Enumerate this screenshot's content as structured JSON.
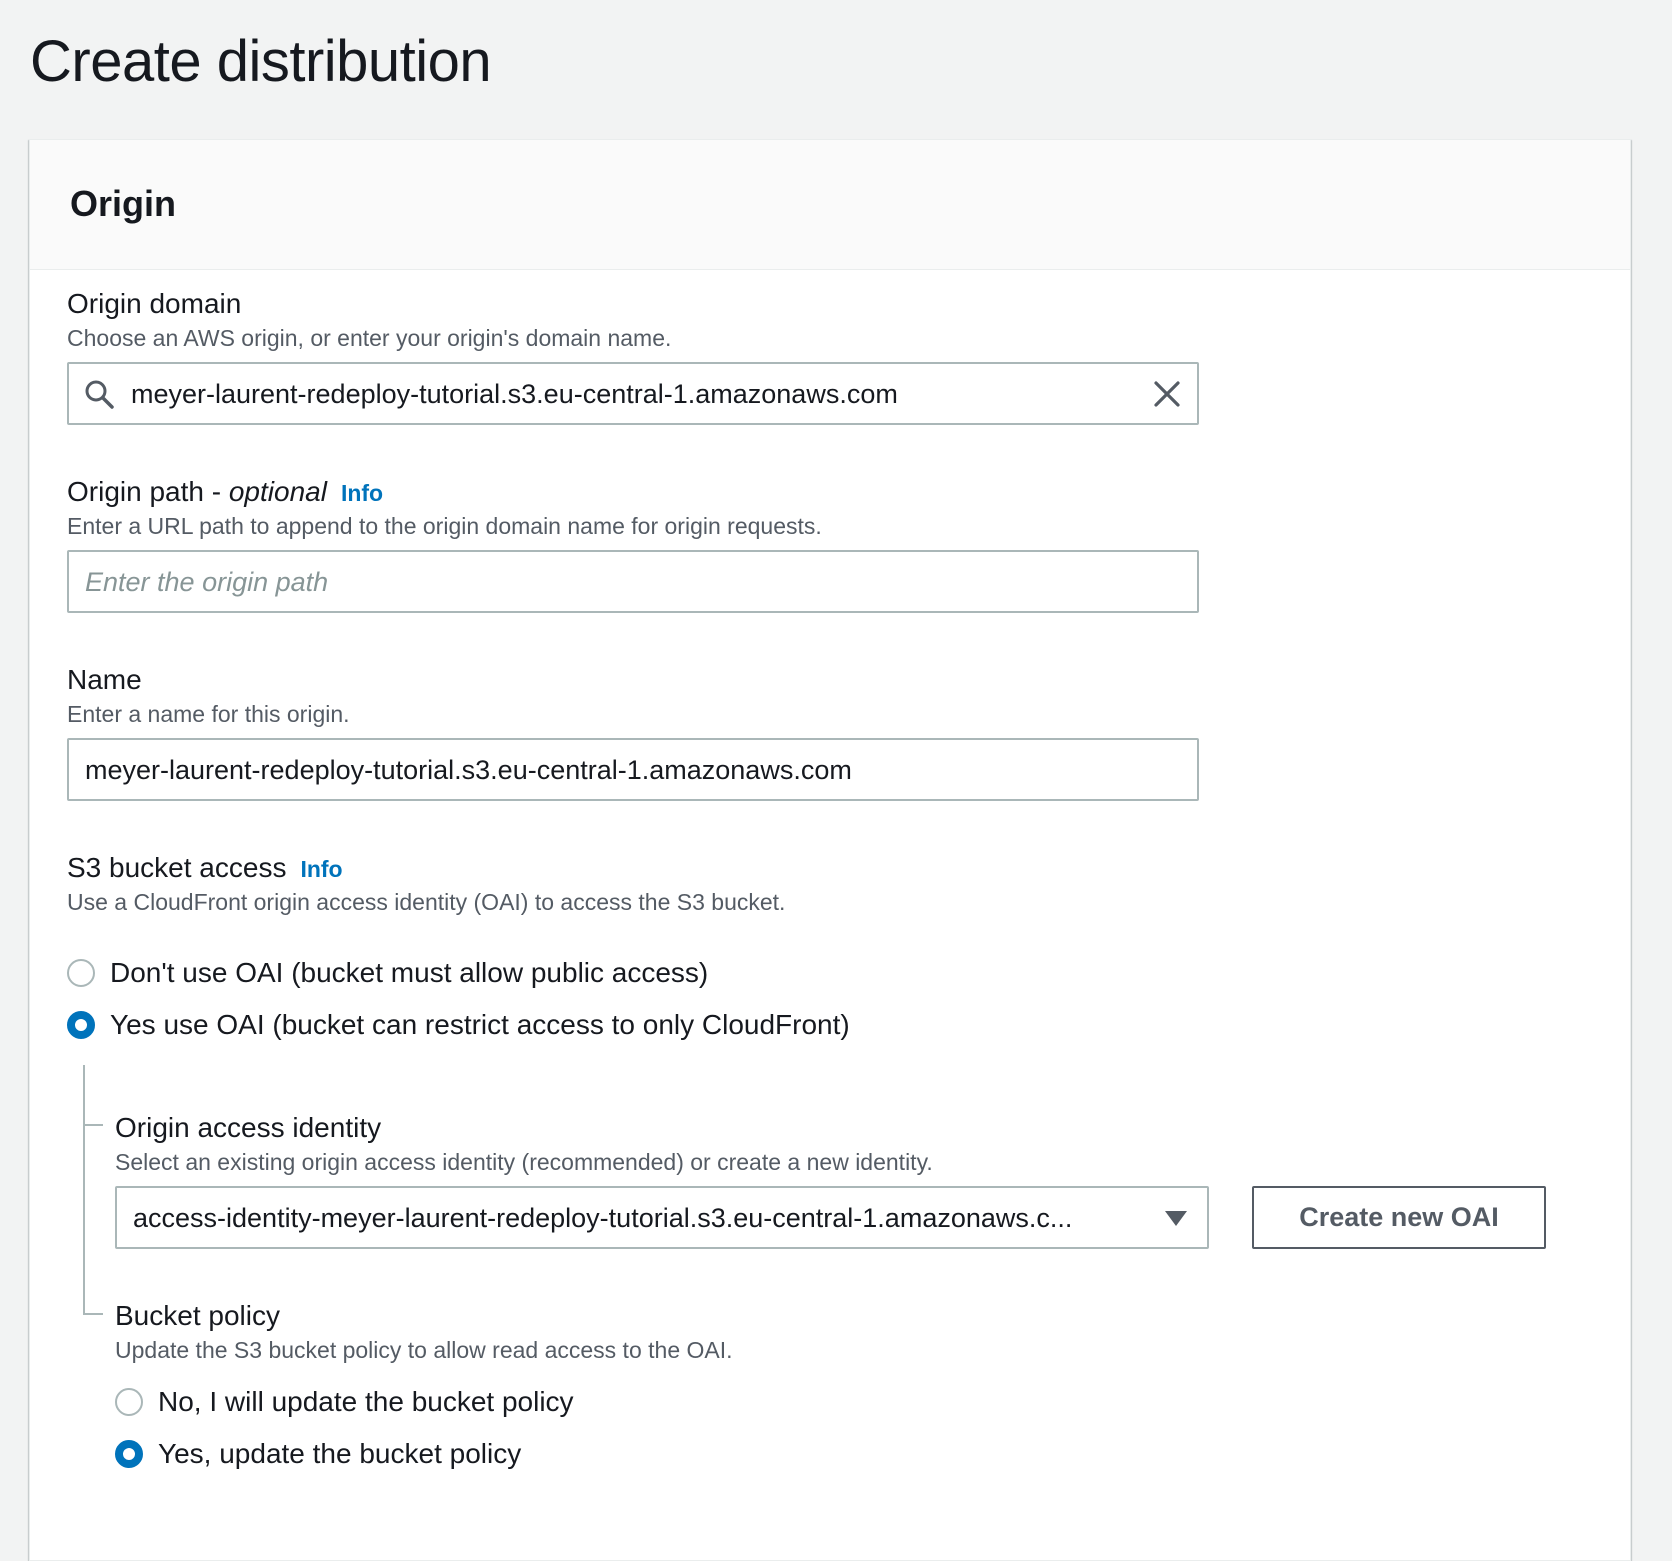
{
  "page": {
    "title": "Create distribution"
  },
  "origin_section": {
    "title": "Origin",
    "origin_domain": {
      "label": "Origin domain",
      "description": "Choose an AWS origin, or enter your origin's domain name.",
      "value": "meyer-laurent-redeploy-tutorial.s3.eu-central-1.amazonaws.com",
      "search_icon": "search-icon",
      "clear_icon": "close-icon"
    },
    "origin_path": {
      "label": "Origin path - ",
      "label_optional": "optional",
      "info": "Info",
      "description": "Enter a URL path to append to the origin domain name for origin requests.",
      "placeholder": "Enter the origin path",
      "value": ""
    },
    "name": {
      "label": "Name",
      "description": "Enter a name for this origin.",
      "value": "meyer-laurent-redeploy-tutorial.s3.eu-central-1.amazonaws.com"
    },
    "s3_bucket_access": {
      "label": "S3 bucket access",
      "info": "Info",
      "description": "Use a CloudFront origin access identity (OAI) to access the S3 bucket.",
      "options": [
        {
          "label": "Don't use OAI (bucket must allow public access)",
          "selected": false
        },
        {
          "label": "Yes use OAI (bucket can restrict access to only CloudFront)",
          "selected": true
        }
      ]
    },
    "origin_access_identity": {
      "label": "Origin access identity",
      "description": "Select an existing origin access identity (recommended) or create a new identity.",
      "selected_value": "access-identity-meyer-laurent-redeploy-tutorial.s3.eu-central-1.amazonaws.c...",
      "dropdown_icon": "caret-down-icon",
      "create_button": "Create new OAI"
    },
    "bucket_policy": {
      "label": "Bucket policy",
      "description": "Update the S3 bucket policy to allow read access to the OAI.",
      "options": [
        {
          "label": "No, I will update the bucket policy",
          "selected": false
        },
        {
          "label": "Yes, update the bucket policy",
          "selected": true
        }
      ]
    }
  },
  "colors": {
    "accent": "#0073bb",
    "background": "#f2f3f3",
    "text": "#16191f",
    "secondary_text": "#545b64",
    "border": "#aab7b8"
  }
}
